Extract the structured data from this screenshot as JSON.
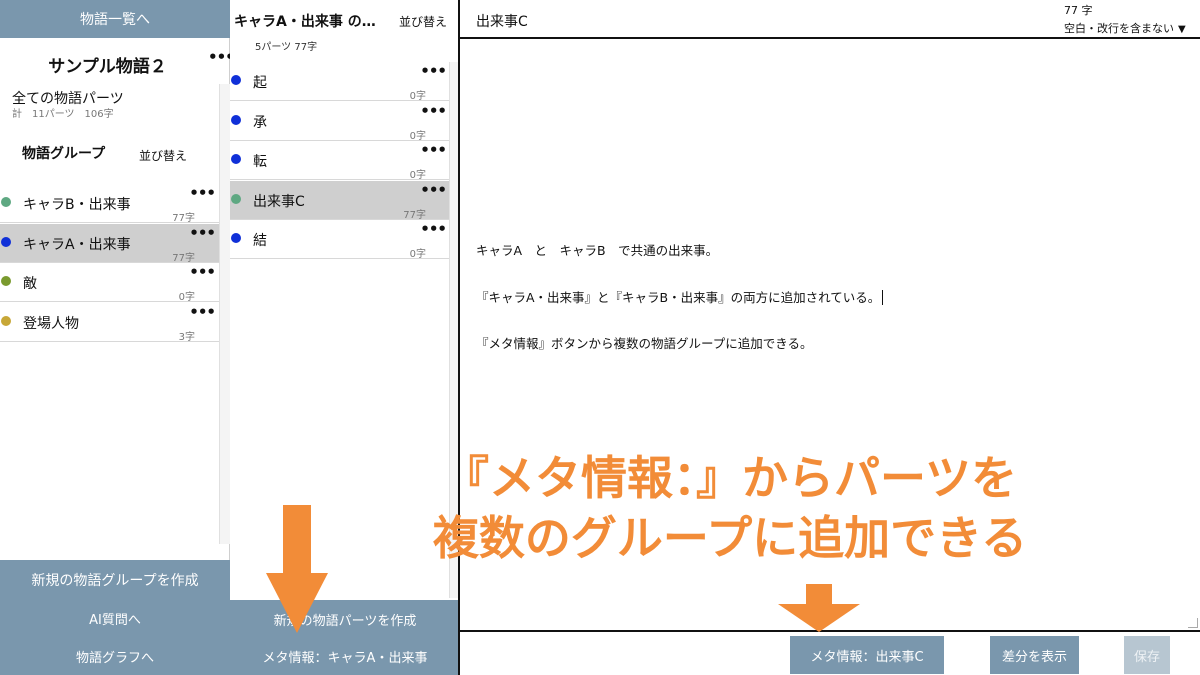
{
  "left_pane": {
    "back_button": "物語一覧へ",
    "story_title": "サンプル物語２",
    "more_menu": "•••",
    "all_parts_label": "全ての物語パーツ",
    "all_parts_count": "計　11パーツ　106字",
    "groups_heading": "物語グループ",
    "groups_sort": "並び替え",
    "groups": [
      {
        "label": "キャラB・出来事",
        "count": "77字",
        "color": "#5ea882",
        "selected": false
      },
      {
        "label": "キャラA・出来事",
        "count": "77字",
        "color": "#1030d8",
        "selected": true
      },
      {
        "label": "敵",
        "count": "0字",
        "color": "#7a9a2e",
        "selected": false
      },
      {
        "label": "登場人物",
        "count": "3字",
        "color": "#c7a737",
        "selected": false
      }
    ],
    "new_group_button": "新規の物語グループを作成",
    "ai_button": "AI質問へ",
    "graph_button": "物語グラフへ"
  },
  "middle_pane": {
    "title": "キャラA・出来事 の…",
    "sort": "並び替え",
    "count": "5パーツ 77字",
    "parts": [
      {
        "label": "起",
        "count": "0字",
        "color": "#1030d8",
        "selected": false
      },
      {
        "label": "承",
        "count": "0字",
        "color": "#1030d8",
        "selected": false
      },
      {
        "label": "転",
        "count": "0字",
        "color": "#1030d8",
        "selected": false
      },
      {
        "label": "出来事C",
        "count": "77字",
        "color": "#5ea882",
        "selected": true
      },
      {
        "label": "結",
        "count": "0字",
        "color": "#1030d8",
        "selected": false
      }
    ],
    "new_part_button": "新規の物語パーツを作成",
    "meta_button": "メタ情報：キャラA・出来事"
  },
  "editor": {
    "part_name": "出来事C",
    "char_count": "77 字",
    "count_mode": "空白・改行を含まない",
    "paragraphs": [
      "キャラA　と　キャラB　で共通の出来事。",
      "『キャラA・出来事』と『キャラB・出来事』の両方に追加されている。",
      "『メタ情報』ボタンから複数の物語グループに追加できる。"
    ],
    "meta_button": "メタ情報：出来事C",
    "diff_button": "差分を表示",
    "save_button": "保存"
  },
  "annotation": {
    "line1": "『メタ情報：』からパーツを",
    "line2": "複数のグループに追加できる"
  },
  "colors": {
    "accent": "#7a97ad",
    "annotation": "#f28c38",
    "selected_row": "#cfcfcf"
  }
}
